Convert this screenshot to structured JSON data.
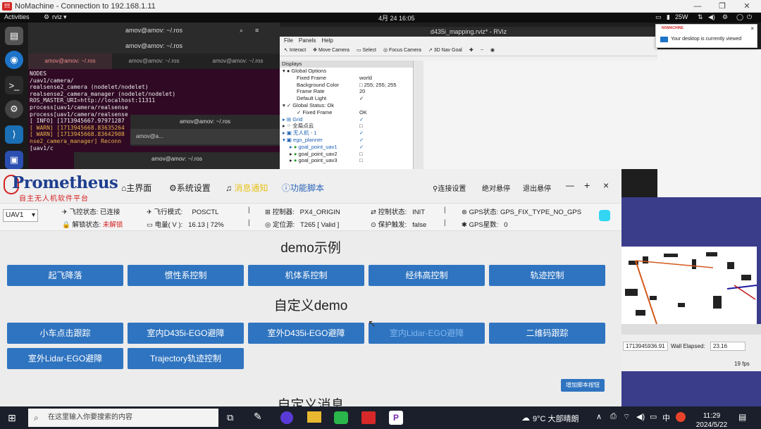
{
  "nomachine": {
    "title": "NoMachine - Connection to 192.168.1.11",
    "logo": "!!!"
  },
  "ubuntu": {
    "activities": "Activities",
    "app": "rviz",
    "clock": "4月 24  16:05",
    "power": "25W"
  },
  "terminal_main": {
    "title": "amov@amov: ~/.ros",
    "tabs": [
      "amov@amov: ~/.ros",
      "amov@amov: ~/.ros",
      "amov@amov: ~/.ros"
    ],
    "lines": [
      "NODES",
      "  /uav1/camera/",
      "    realsense2_camera (nodelet/nodelet)",
      "    realsense2_camera_manager (nodelet/nodelet)",
      "",
      "ROS_MASTER_URI=http://localhost:11311",
      "",
      "process[uav1/camera/realsense",
      "process[uav1/camera/realsense",
      "[ INFO] [1713945667.97971287",
      "[ WARN] [1713945668.83635264",
      "[ WARN] [1713945668.83642908",
      "nse2_camera_manager] Reconn",
      "[uav1/c"
    ]
  },
  "terminal_small": {
    "title": "amov@amov: ~/.ros",
    "tab": "amov@a..."
  },
  "terminal_small2": {
    "title": "amov@amov: ~/.ros"
  },
  "rviz": {
    "title": "d435i_mapping.rviz* - RViz",
    "menu": [
      "File",
      "Panels",
      "Help"
    ],
    "tools": [
      "Interact",
      "Move Camera",
      "Select",
      "Focus Camera",
      "3D Nav Goal"
    ],
    "panel_title": "Displays",
    "rows": [
      {
        "label": "Global Options",
        "value": ""
      },
      {
        "label": "Fixed Frame",
        "value": "world"
      },
      {
        "label": "Background Color",
        "value": "255; 255; 255"
      },
      {
        "label": "Frame Rate",
        "value": "20"
      },
      {
        "label": "Default Light",
        "value": "✓"
      },
      {
        "label": "Global Status: Ok",
        "value": ""
      },
      {
        "label": "Fixed Frame",
        "value": "OK"
      },
      {
        "label": "Grid",
        "value": "✓"
      },
      {
        "label": "全局点云",
        "value": ""
      },
      {
        "label": "无人机 - 1",
        "value": "✓"
      },
      {
        "label": "ego_planner",
        "value": "✓"
      },
      {
        "label": "goal_point_uav1",
        "value": "✓"
      },
      {
        "label": "goal_point_uav2",
        "value": ""
      },
      {
        "label": "goal_point_uav3",
        "value": ""
      }
    ],
    "time_value": "1713945936.91",
    "wall_elapsed_label": "Wall Elapsed:",
    "wall_elapsed": "23.16",
    "fps": "19 fps"
  },
  "notification": {
    "brand": "NOMACHINE",
    "text": "Your desktop is currently viewed"
  },
  "prometheus": {
    "logo_title": "Prometheus",
    "logo_sub": "自主无人机软件平台",
    "nav": {
      "home": "主界面",
      "settings": "系统设置",
      "notice": "消息通知",
      "scripts": "功能脚本"
    },
    "nav_right": {
      "connect": "连接设置",
      "abs_hover": "绝对悬停",
      "exit_hover": "退出悬停",
      "min": "—",
      "max": "+",
      "close": "×"
    },
    "uav_select": "UAV1",
    "status": {
      "link_label": "飞控状态:",
      "link_value": "已连接",
      "arm_label": "解锁状态:",
      "arm_value": "未解锁",
      "mode_label": "飞行模式:",
      "mode_value": "POSCTL",
      "battery_label": "电量( V ):",
      "battery_value": "16.13 | 72%",
      "controller_label": "控制器:",
      "controller_value": "PX4_ORIGIN",
      "locator_label": "定位源:",
      "locator_value": "T265 [ Valid ]",
      "control_label": "控制状态:",
      "control_value": "INIT",
      "protect_label": "保护触发:",
      "protect_value": "false",
      "gps_label": "GPS状态:",
      "gps_value": "GPS_FIX_TYPE_NO_GPS",
      "sats_label": "GPS星数:",
      "sats_value": "0",
      "sep": "|"
    },
    "section1_title": "demo示例",
    "section1_buttons": [
      "起飞降落",
      "惯性系控制",
      "机体系控制",
      "经纬高控制",
      "轨迹控制"
    ],
    "section2_title": "自定义demo",
    "section2_buttons": [
      "小车点击跟踪",
      "室内D435i-EGO避障",
      "室外D435i-EGO避障",
      "室内Lidar-EGO避障",
      "二维码跟踪",
      "室外Lidar-EGO避障",
      "Trajectory轨迹控制"
    ],
    "add_button": "增加脚本按钮",
    "section3_title": "自定义消息"
  },
  "taskbar": {
    "search_placeholder": "在这里输入你要搜索的内容",
    "weather": "9°C  大部晴朗",
    "ime": "中",
    "time": "11:29",
    "date": "2024/5/22"
  },
  "colors": {
    "accent": "#2f74c0",
    "warn": "#e8b04a",
    "terminal_bg": "#300a24",
    "logo_blue": "#1e3f8f",
    "logo_red": "#d42020"
  }
}
